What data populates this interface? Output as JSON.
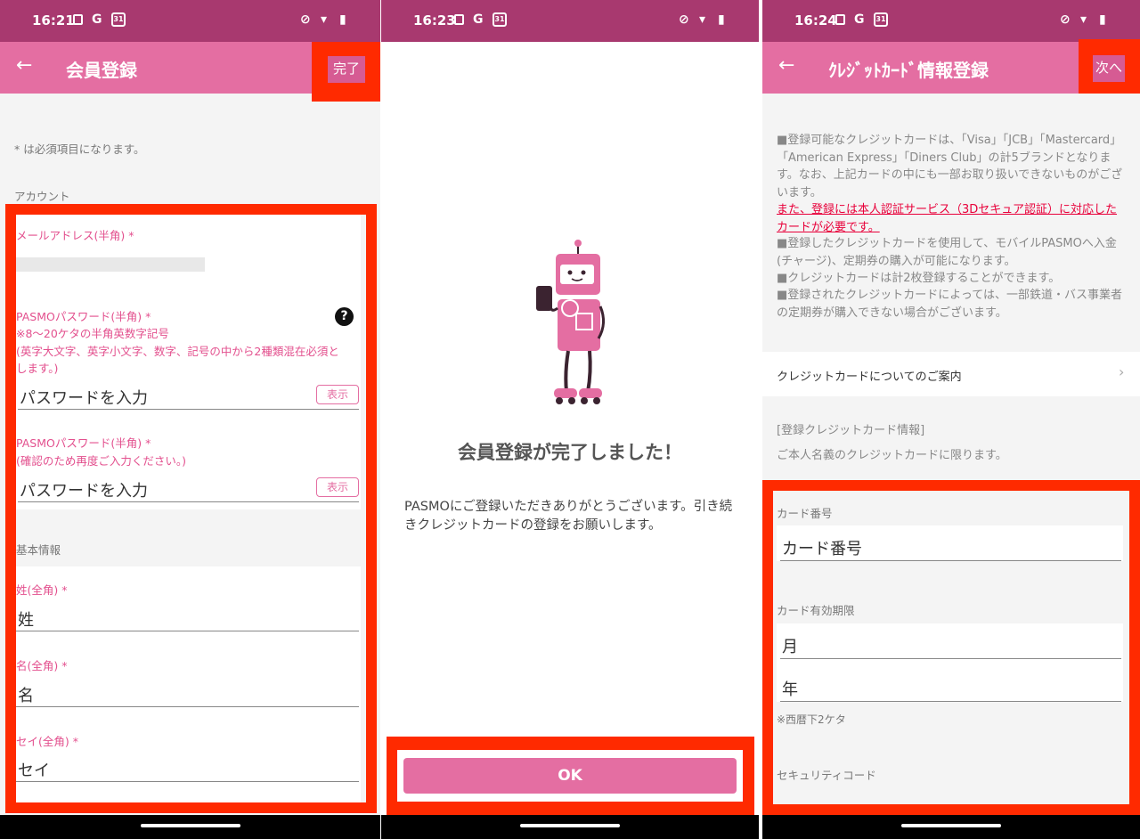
{
  "colors": {
    "status": "#a8396f",
    "appbar": "#e46ea2",
    "highlight": "#ff2a00",
    "pink_text": "#e3508e",
    "notice_red": "#e8003a"
  },
  "status": {
    "times": [
      "16:21",
      "16:23",
      "16:24"
    ],
    "cal_date": "31",
    "g_icon": "G"
  },
  "screen1": {
    "title": "会員登録",
    "done_label": "完了",
    "required_note": "* は必須項目になります。",
    "section_account": "アカウント",
    "email_label": "メールアドレス(半角) *",
    "pwd_label": "PASMOパスワード(半角) *",
    "pwd_help1": "※8～20ケタの半角英数字記号",
    "pwd_help2": "(英字大文字、英字小文字、数字、記号の中から2種類混在必須と",
    "pwd_help3": "します。)",
    "pwd_placeholder": "パスワードを入力",
    "show_label": "表示",
    "pwd2_label": "PASMOパスワード(半角) *",
    "pwd2_help": "(確認のため再度ご入力ください。)",
    "pwd2_placeholder": "パスワードを入力",
    "section_basic": "基本情報",
    "sei_label": "姓(全角) *",
    "sei_placeholder": "姓",
    "mei_label": "名(全角) *",
    "mei_placeholder": "名",
    "seikana_label": "セイ(全角) *",
    "seikana_placeholder": "セイ"
  },
  "screen2": {
    "heading": "会員登録が完了しました！",
    "message": "PASMOにご登録いただきありがとうございます。引き続きクレジットカードの登録をお願いします。",
    "ok_label": "OK"
  },
  "screen3": {
    "title": "ｸﾚｼﾞｯﾄｶｰﾄﾞ情報登録",
    "next_label": "次へ",
    "info1": "■登録可能なクレジットカードは、「Visa」「JCB」「Mastercard」「American Express」「Diners Club」の計5ブランドとなります。なお、上記カードの中にも一部お取り扱いできないものがございます。",
    "info_red": "また、登録には本人認証サービス（3Dセキュア認証）に対応したカードが必要です。",
    "info2": "■登録したクレジットカードを使用して、モバイルPASMOへ入金(チャージ)、定期券の購入が可能になります。",
    "info3": "■クレジットカードは計2枚登録することができます。",
    "info4": "■登録されたクレジットカードによっては、一部鉄道・バス事業者の定期券が購入できない場合がございます。",
    "guide_link": "クレジットカードについてのご案内",
    "section_card": "[登録クレジットカード情報]",
    "card_note": "ご本人名義のクレジットカードに限ります。",
    "cardnum_label": "カード番号",
    "cardnum_placeholder": "カード番号",
    "expiry_label": "カード有効期限",
    "month_placeholder": "月",
    "year_placeholder": "年",
    "year_note": "※西暦下2ケタ",
    "cvc_label": "セキュリティコード"
  }
}
